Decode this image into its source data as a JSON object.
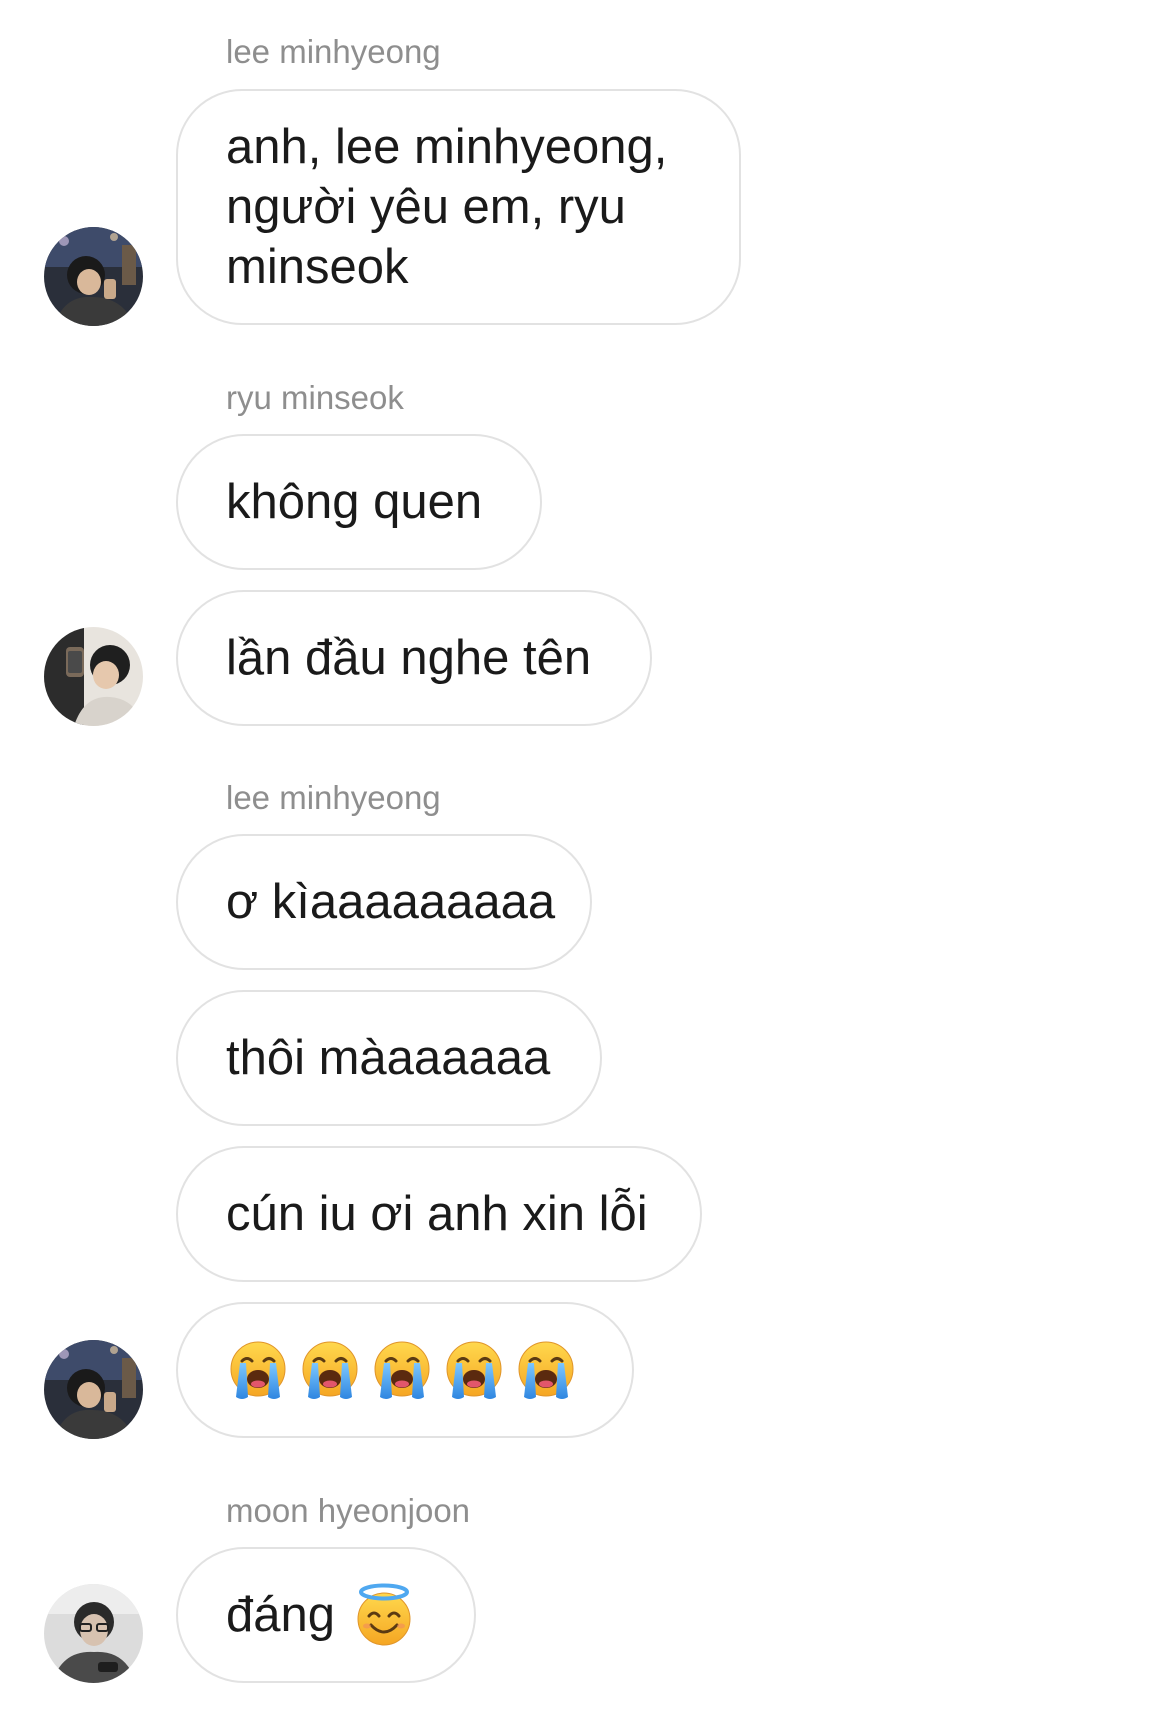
{
  "messages": [
    {
      "sender": "lee minhyeong",
      "text": "anh, lee minhyeong, người yêu em, ryu minseok"
    },
    {
      "sender": "ryu minseok",
      "texts": [
        "không quen",
        "lần đầu nghe tên"
      ]
    },
    {
      "sender": "lee minhyeong",
      "texts": [
        "ơ kìaaaaaaaaa",
        "thôi màaaaaaa",
        "cún iu ơi anh xin lỗi"
      ],
      "emoji_bubble": [
        "loudly-crying-face-icon",
        "loudly-crying-face-icon",
        "loudly-crying-face-icon",
        "loudly-crying-face-icon",
        "loudly-crying-face-icon"
      ]
    },
    {
      "sender": "moon hyeonjoon",
      "text": "đáng",
      "emoji": "smiling-face-with-halo-icon"
    }
  ],
  "colors": {
    "sender_name": "#8e8e8e",
    "bubble_border": "#e2e2e2",
    "text": "#1a1a1a",
    "background": "#ffffff"
  }
}
